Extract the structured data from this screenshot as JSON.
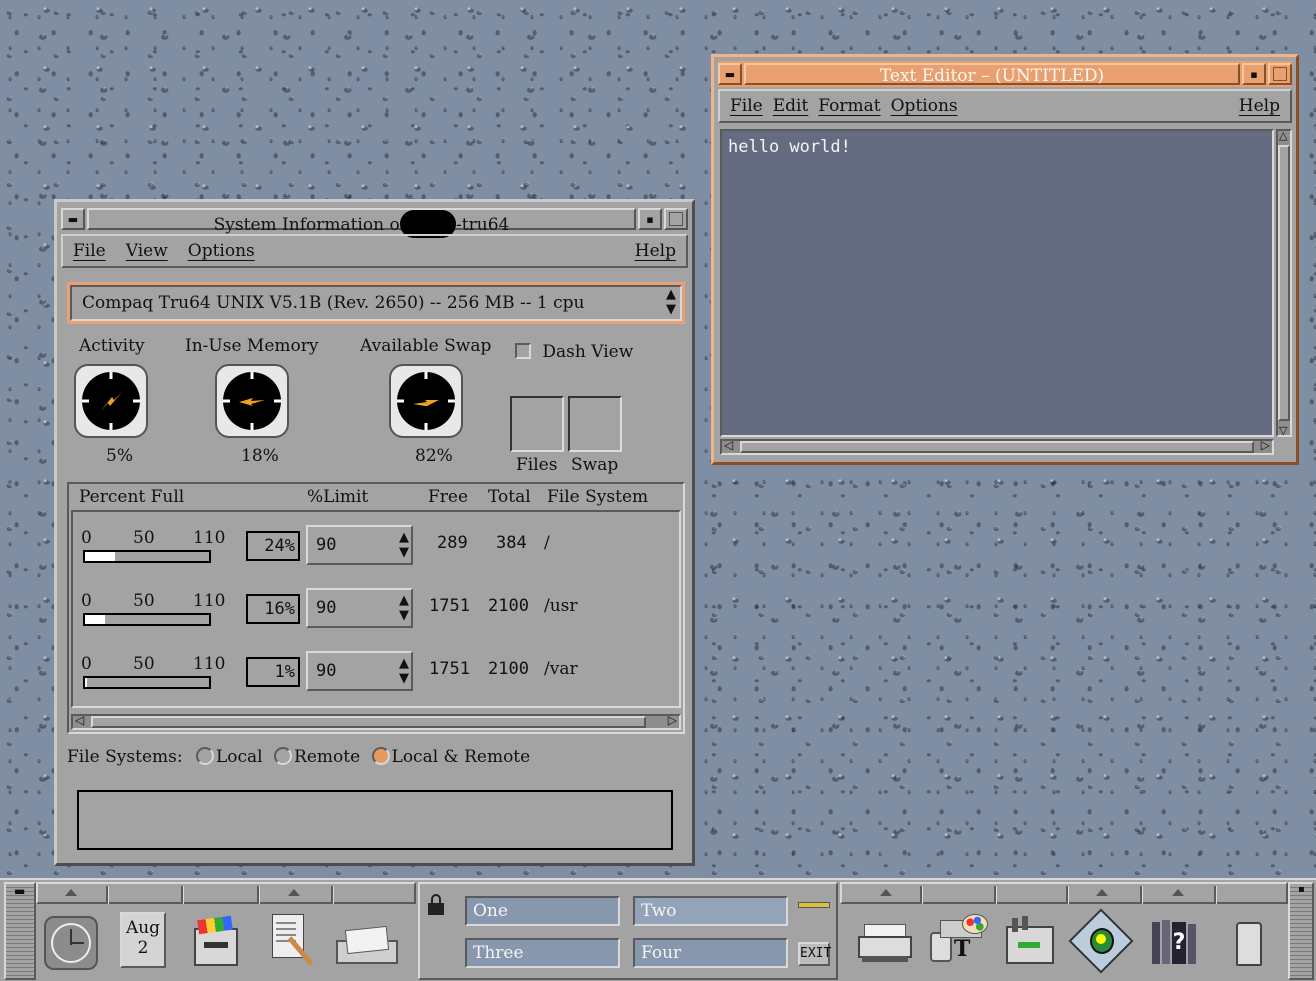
{
  "sysinfo": {
    "title": "System Information on ",
    "title_host_suffix": "-tru64",
    "menu": {
      "file": "File",
      "view": "View",
      "options": "Options",
      "help": "Help"
    },
    "system_select": "Compaq Tru64 UNIX V5.1B (Rev. 2650) -- 256 MB -- 1 cpu",
    "gauges": [
      {
        "label": "Activity",
        "value": "5%"
      },
      {
        "label": "In-Use Memory",
        "value": "18%"
      },
      {
        "label": "Available Swap",
        "value": "82%"
      }
    ],
    "dash_view_label": "Dash View",
    "files_label": "Files",
    "swap_label": "Swap",
    "table_headers": {
      "percent_full": "Percent Full",
      "limit": "%Limit",
      "free": "Free",
      "total": "Total",
      "file_system": "File System"
    },
    "scale": {
      "s0": "0",
      "s50": "50",
      "s110": "110"
    },
    "rows": [
      {
        "percent": "24%",
        "fill": 0.24,
        "limit": "90",
        "free": "289",
        "total": "384",
        "fs": "/"
      },
      {
        "percent": "16%",
        "fill": 0.16,
        "limit": "90",
        "free": "1751",
        "total": "2100",
        "fs": "/usr"
      },
      {
        "percent": "1%",
        "fill": 0.01,
        "limit": "90",
        "free": "1751",
        "total": "2100",
        "fs": "/var"
      }
    ],
    "fs_label": "File Systems:",
    "radio_local": "Local",
    "radio_remote": "Remote",
    "radio_both": "Local & Remote",
    "radio_selected": "Local & Remote"
  },
  "editor": {
    "title": "Text Editor – (UNTITLED)",
    "menu": {
      "file": "File",
      "edit": "Edit",
      "format": "Format",
      "options": "Options",
      "help": "Help"
    },
    "content": "hello world!"
  },
  "panel": {
    "date_month": "Aug",
    "date_day": "2",
    "workspaces": [
      "One",
      "Two",
      "Three",
      "Four"
    ],
    "active_workspace": "Two",
    "exit_label": "EXIT"
  },
  "colors": {
    "desktop": "#7f8ea3",
    "active_frame": "#e8a070",
    "window": "#a3a3a3",
    "workspace": "#8797ad",
    "editor_bg": "#656b81"
  }
}
